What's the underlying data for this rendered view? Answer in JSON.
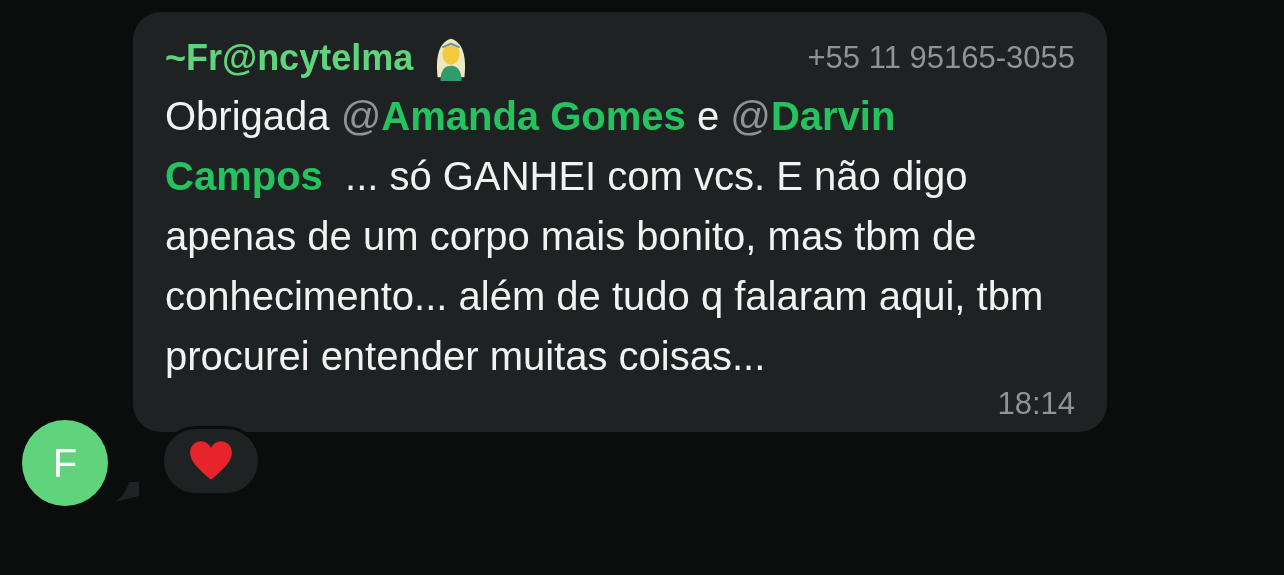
{
  "message": {
    "sender": {
      "name": "~Fr@ncytelma",
      "avatar_initial": "F",
      "phone": "+55 11 95165-3055"
    },
    "text": [
      {
        "kind": "plain",
        "text": "Obrigada "
      },
      {
        "kind": "at",
        "text": "@"
      },
      {
        "kind": "mention",
        "text": "Amanda Gomes"
      },
      {
        "kind": "plain",
        "text": " e "
      },
      {
        "kind": "at",
        "text": "@"
      },
      {
        "kind": "mention",
        "text": "Darvin Campos"
      },
      {
        "kind": "plain",
        "text": "  ... só GANHEI com vcs. E não digo apenas de um corpo mais bonito, mas tbm de conhecimento... além de tudo q falaram aqui, tbm procurei entender muitas coisas..."
      }
    ],
    "time": "18:14",
    "reactions": [
      {
        "kind": "heart"
      }
    ]
  }
}
